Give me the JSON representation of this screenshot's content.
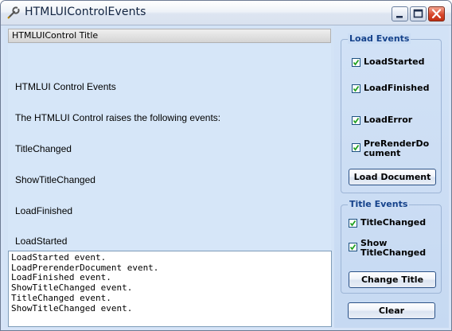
{
  "window": {
    "title": "HTMLUIControlEvents",
    "icon": "wrench-icon",
    "controls": [
      "minimize",
      "maximize",
      "close"
    ]
  },
  "html_control": {
    "title": "HTMLUIControl Title",
    "lines": [
      "HTMLUI Control Events",
      "The HTMLUI Control raises the following events:",
      "TitleChanged",
      "ShowTitleChanged",
      "LoadFinished",
      "LoadStarted"
    ]
  },
  "log": {
    "entries": [
      "LoadStarted event.",
      "LoadPrerenderDocument event.",
      "LoadFinished event.",
      "ShowTitleChanged event.",
      "TitleChanged event.",
      "ShowTitleChanged event."
    ]
  },
  "load_events": {
    "label": "Load Events",
    "checkboxes": [
      {
        "label": "LoadStarted",
        "checked": true
      },
      {
        "label": "LoadFinished",
        "checked": true
      },
      {
        "label": "LoadError",
        "checked": true
      },
      {
        "label_line1": "PreRenderDo",
        "label_line2": "cument",
        "checked": true
      }
    ],
    "button": "Load Document"
  },
  "title_events": {
    "label": "Title Events",
    "checkboxes": [
      {
        "label": "TitleChanged",
        "checked": true
      },
      {
        "label_line1": "Show",
        "label_line2": "TitleChanged",
        "checked": true
      }
    ],
    "button": "Change Title"
  },
  "clear_button": "Clear",
  "colors": {
    "group_label": "#15428b",
    "panel_bg": "#d3e3f6",
    "close_button": "#d8472c"
  }
}
